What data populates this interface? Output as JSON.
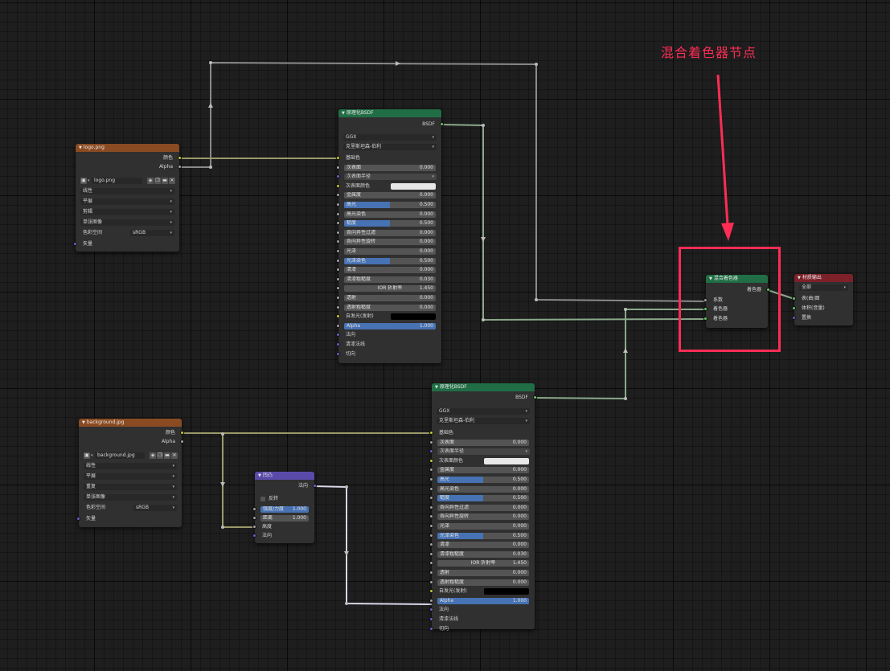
{
  "annotation": {
    "label": "混合着色器节点",
    "color": "#ff2d55"
  },
  "logo_image_node": {
    "title": "logo.png",
    "outputs": {
      "color": "颜色",
      "alpha": "Alpha"
    },
    "image_name": "logo.png",
    "interpolation": "线性",
    "projection": "平展",
    "extension": "剪辑",
    "source": "单张图像",
    "colorspace_label": "色彩空间",
    "colorspace_value": "sRGB",
    "vector_label": "矢量"
  },
  "bg_image_node": {
    "title": "background.jpg",
    "outputs": {
      "color": "颜色",
      "alpha": "Alpha"
    },
    "image_name": "background.jpg",
    "interpolation": "线性",
    "projection": "平展",
    "extension": "重复",
    "source": "单张图像",
    "colorspace_label": "色彩空间",
    "colorspace_value": "sRGB",
    "vector_label": "矢量"
  },
  "bump_node": {
    "title": "凹凸",
    "output": "法向",
    "invert_label": "反转",
    "strength_label": "强度/力度",
    "strength_value": "1.000",
    "distance_label": "距离",
    "distance_value": "1.000",
    "height_label": "高度",
    "normal_label": "法向"
  },
  "bsdf_top": {
    "title": "原理化BSDF",
    "output": "BSDF",
    "distribution": "GGX",
    "subsurface_method": "克里斯坦森-伯利",
    "params": [
      {
        "label": "基础色",
        "kind": "socket",
        "sock": "yellow"
      },
      {
        "label": "次表面",
        "kind": "slider",
        "value": "0.000",
        "fill": 0,
        "sock": "gray"
      },
      {
        "label": "次表面半径",
        "kind": "dropdown",
        "sock": "purple"
      },
      {
        "label": "次表面颜色",
        "kind": "color",
        "swatch": "#e8e8e8",
        "sock": "yellow"
      },
      {
        "label": "金属度",
        "kind": "slider",
        "value": "0.000",
        "fill": 0,
        "sock": "gray"
      },
      {
        "label": "高光",
        "kind": "slider",
        "value": "0.500",
        "fill": 0.5,
        "sock": "gray"
      },
      {
        "label": "高光染色",
        "kind": "slider",
        "value": "0.000",
        "fill": 0,
        "sock": "gray"
      },
      {
        "label": "糙度",
        "kind": "slider",
        "value": "0.500",
        "fill": 0.5,
        "sock": "gray"
      },
      {
        "label": "各向异性过滤",
        "kind": "slider",
        "value": "0.000",
        "fill": 0,
        "sock": "gray"
      },
      {
        "label": "各向异性旋转",
        "kind": "slider",
        "value": "0.000",
        "fill": 0,
        "sock": "gray"
      },
      {
        "label": "光泽",
        "kind": "slider",
        "value": "0.000",
        "fill": 0,
        "sock": "gray"
      },
      {
        "label": "光泽染色",
        "kind": "slider",
        "value": "0.500",
        "fill": 0.5,
        "sock": "gray"
      },
      {
        "label": "清漆",
        "kind": "slider",
        "value": "0.000",
        "fill": 0,
        "sock": "gray"
      },
      {
        "label": "清漆粗糙度",
        "kind": "slider",
        "value": "0.030",
        "fill": 0,
        "sock": "gray"
      },
      {
        "label": "IOR 折射率",
        "kind": "slider-center",
        "value": "1.450",
        "fill": 0,
        "sock": "gray"
      },
      {
        "label": "透射",
        "kind": "slider",
        "value": "0.000",
        "fill": 0,
        "sock": "gray"
      },
      {
        "label": "透射粗糙度",
        "kind": "slider",
        "value": "0.000",
        "fill": 0,
        "sock": "gray"
      },
      {
        "label": "自发光(发射)",
        "kind": "color",
        "swatch": "#000000",
        "sock": "yellow"
      },
      {
        "label": "Alpha",
        "kind": "slider",
        "value": "1.000",
        "fill": 1,
        "sock": "gray"
      },
      {
        "label": "法向",
        "kind": "socket",
        "sock": "purple"
      },
      {
        "label": "清漆法线",
        "kind": "socket",
        "sock": "purple"
      },
      {
        "label": "切向",
        "kind": "socket",
        "sock": "purple"
      }
    ]
  },
  "bsdf_bottom": {
    "title": "原理化BSDF",
    "output": "BSDF",
    "distribution": "GGX",
    "subsurface_method": "克里斯坦森-伯利",
    "params": [
      {
        "label": "基础色",
        "kind": "socket",
        "sock": "yellow"
      },
      {
        "label": "次表面",
        "kind": "slider",
        "value": "0.000",
        "fill": 0,
        "sock": "gray"
      },
      {
        "label": "次表面半径",
        "kind": "dropdown",
        "sock": "purple"
      },
      {
        "label": "次表面颜色",
        "kind": "color",
        "swatch": "#e8e8e8",
        "sock": "yellow"
      },
      {
        "label": "金属度",
        "kind": "slider",
        "value": "0.000",
        "fill": 0,
        "sock": "gray"
      },
      {
        "label": "高光",
        "kind": "slider",
        "value": "0.500",
        "fill": 0.5,
        "sock": "gray"
      },
      {
        "label": "高光染色",
        "kind": "slider",
        "value": "0.000",
        "fill": 0,
        "sock": "gray"
      },
      {
        "label": "糙度",
        "kind": "slider",
        "value": "0.500",
        "fill": 0.5,
        "sock": "gray"
      },
      {
        "label": "各向异性过滤",
        "kind": "slider",
        "value": "0.000",
        "fill": 0,
        "sock": "gray"
      },
      {
        "label": "各向异性旋转",
        "kind": "slider",
        "value": "0.000",
        "fill": 0,
        "sock": "gray"
      },
      {
        "label": "光泽",
        "kind": "slider",
        "value": "0.000",
        "fill": 0,
        "sock": "gray"
      },
      {
        "label": "光泽染色",
        "kind": "slider",
        "value": "0.500",
        "fill": 0.5,
        "sock": "gray"
      },
      {
        "label": "清漆",
        "kind": "slider",
        "value": "0.000",
        "fill": 0,
        "sock": "gray"
      },
      {
        "label": "清漆粗糙度",
        "kind": "slider",
        "value": "0.030",
        "fill": 0,
        "sock": "gray"
      },
      {
        "label": "IOR 折射率",
        "kind": "slider-center",
        "value": "1.450",
        "fill": 0,
        "sock": "gray"
      },
      {
        "label": "透射",
        "kind": "slider",
        "value": "0.000",
        "fill": 0,
        "sock": "gray"
      },
      {
        "label": "透射粗糙度",
        "kind": "slider",
        "value": "0.000",
        "fill": 0,
        "sock": "gray"
      },
      {
        "label": "自发光(发射)",
        "kind": "color",
        "swatch": "#000000",
        "sock": "yellow"
      },
      {
        "label": "Alpha",
        "kind": "slider",
        "value": "1.000",
        "fill": 1,
        "sock": "gray"
      },
      {
        "label": "法向",
        "kind": "socket",
        "sock": "purple"
      },
      {
        "label": "清漆法线",
        "kind": "socket",
        "sock": "purple"
      },
      {
        "label": "切向",
        "kind": "socket",
        "sock": "purple"
      }
    ]
  },
  "mix_node": {
    "title": "混合着色器",
    "output": "着色器",
    "fac": "系数",
    "shader1": "着色器",
    "shader2": "着色器"
  },
  "output_node": {
    "title": "材质输出",
    "target": "全部",
    "surface": "表(曲)面",
    "volume": "体积(音量)",
    "displacement": "置换"
  },
  "colors": {
    "grid_bg": "#1e1e1e",
    "texture_header": "#8a4b22",
    "shader_header": "#216e46",
    "vector_header": "#5a4bab",
    "output_header": "#7d2129",
    "slider_fill": "#4772b3",
    "socket_color": "#c7c729",
    "socket_float": "#a1a1a1",
    "socket_shader": "#63c763",
    "socket_vector": "#6363c7"
  }
}
